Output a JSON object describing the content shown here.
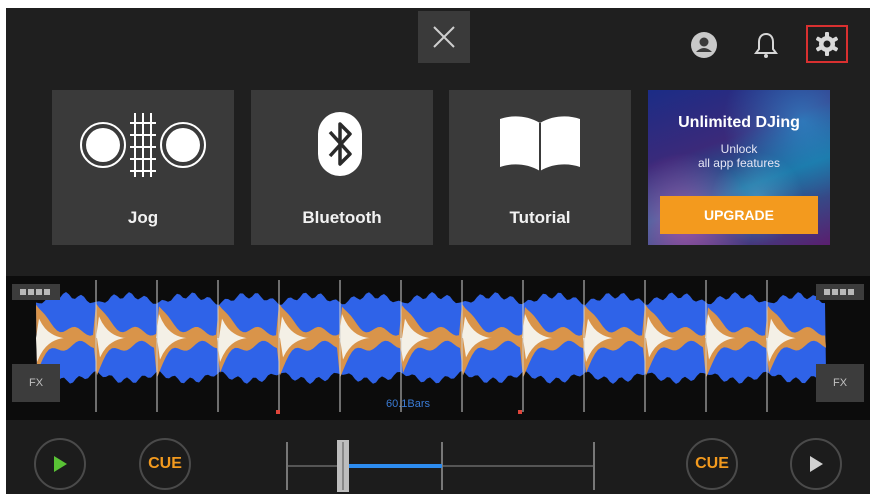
{
  "cards": [
    {
      "label": "Jog",
      "icon": "jog-wheels-icon"
    },
    {
      "label": "Bluetooth",
      "icon": "bluetooth-icon"
    },
    {
      "label": "Tutorial",
      "icon": "book-icon"
    }
  ],
  "promo": {
    "title": "Unlimited DJing",
    "subtitle_line1": "Unlock",
    "subtitle_line2": "all app features",
    "button_label": "UPGRADE"
  },
  "top_bar": {
    "close_icon": "close-icon",
    "account_icon": "account-icon",
    "notification_icon": "bell-icon",
    "settings_icon": "gear-icon",
    "highlight_color": "#d93030"
  },
  "waveform": {
    "fx_left": "FX",
    "fx_right": "FX",
    "bars_label": "60.1Bars"
  },
  "controls": {
    "cue_left": "CUE",
    "cue_right": "CUE",
    "play_left_icon": "play-icon",
    "play_right_icon": "play-icon"
  },
  "colors": {
    "accent_orange": "#f39a1e",
    "wave_blue": "#2f63e8",
    "wave_orange": "#d9944a",
    "play_green": "#59c235",
    "crossfader_blue": "#2d8cf0"
  }
}
